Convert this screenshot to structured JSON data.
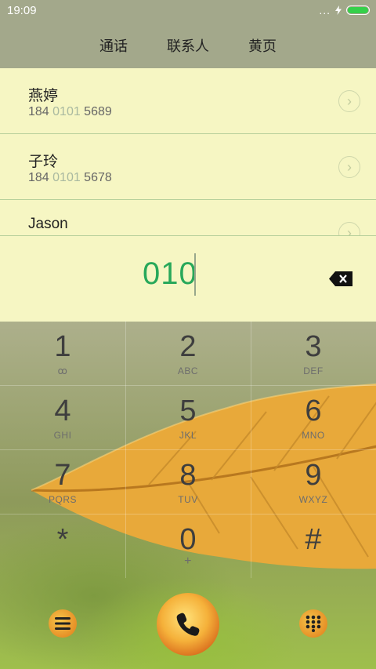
{
  "status_bar": {
    "time": "19:09",
    "more_indicator": "..."
  },
  "tabs": [
    {
      "label": "通话"
    },
    {
      "label": "联系人"
    },
    {
      "label": "黄页"
    }
  ],
  "contacts": [
    {
      "name": "燕婷",
      "number_prefix": "184 ",
      "number_match": "0101",
      "number_suffix": " 5689"
    },
    {
      "name": "子玲",
      "number_prefix": "184 ",
      "number_match": "0101",
      "number_suffix": " 5678"
    },
    {
      "name": "Jason"
    }
  ],
  "dial_input": {
    "value": "010"
  },
  "keypad": [
    {
      "digit": "1",
      "letters": "ꝏ"
    },
    {
      "digit": "2",
      "letters": "ABC"
    },
    {
      "digit": "3",
      "letters": "DEF"
    },
    {
      "digit": "4",
      "letters": "GHI"
    },
    {
      "digit": "5",
      "letters": "JKL"
    },
    {
      "digit": "6",
      "letters": "MNO"
    },
    {
      "digit": "7",
      "letters": "PQRS"
    },
    {
      "digit": "8",
      "letters": "TUV"
    },
    {
      "digit": "9",
      "letters": "WXYZ"
    },
    {
      "digit": "*",
      "letters": ""
    },
    {
      "digit": "0",
      "letters": "+"
    },
    {
      "digit": "#",
      "letters": ""
    }
  ],
  "icons": {
    "chevron": "›",
    "backspace": "backspace-icon",
    "menu": "menu-icon",
    "call": "phone-icon",
    "dialpad": "dialpad-icon"
  },
  "colors": {
    "accent_green": "#28a85a",
    "header_bg": "#a3a88b",
    "list_bg": "#f6f6c3",
    "battery": "#35d04a"
  }
}
